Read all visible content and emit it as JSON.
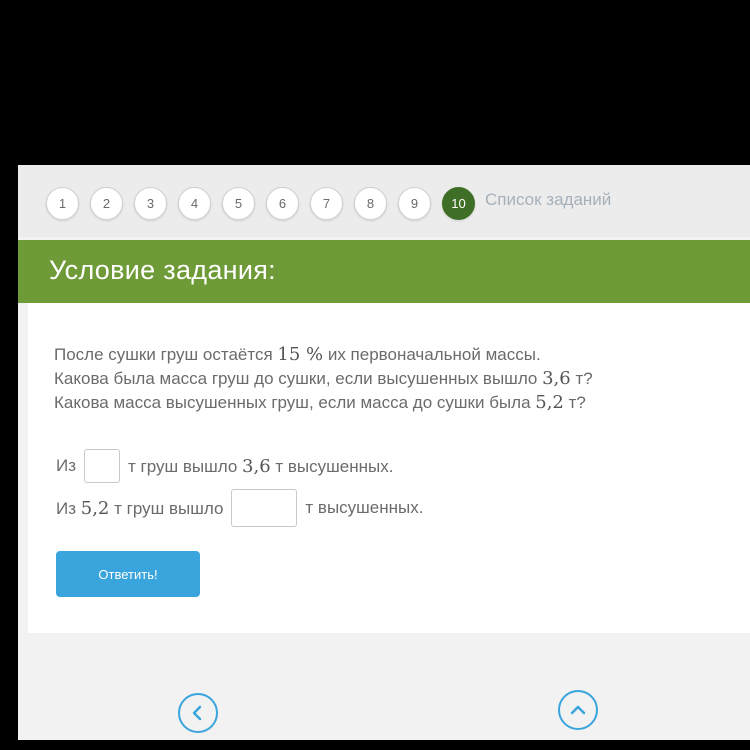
{
  "nav": {
    "steps": [
      "1",
      "2",
      "3",
      "4",
      "5",
      "6",
      "7",
      "8",
      "9",
      "10"
    ],
    "active_step": "10",
    "task_list_label": "Список заданий"
  },
  "header": {
    "title": "Условие задания:"
  },
  "problem": {
    "line1_a": "После сушки груш остаётся ",
    "line1_num": "15 %",
    "line1_b": " их первоначальной массы.",
    "line2_a": "Какова была масса груш до сушки, если высушенных вышло ",
    "line2_num": "3,6",
    "line2_b": " т?",
    "line3_a": "Какова масса высушенных груш, если масса до сушки была ",
    "line3_num": "5,2",
    "line3_b": " т?"
  },
  "answers": {
    "row1_prefix": "Из",
    "row1_value": "",
    "row1_suffix_a": "т груш вышло ",
    "row1_suffix_num": "3,6",
    "row1_suffix_b": " т высушенных.",
    "row2_prefix": "Из ",
    "row2_num": "5,2",
    "row2_mid": " т груш вышло",
    "row2_value": "",
    "row2_suffix": "т высушенных."
  },
  "submit_label": "Ответить!",
  "colors": {
    "header_green": "#6e9a37",
    "active_step": "#3f6f26",
    "accent_blue": "#3aa4dc"
  },
  "icons": {
    "prev": "chevron-left-icon",
    "up": "chevron-up-icon"
  }
}
